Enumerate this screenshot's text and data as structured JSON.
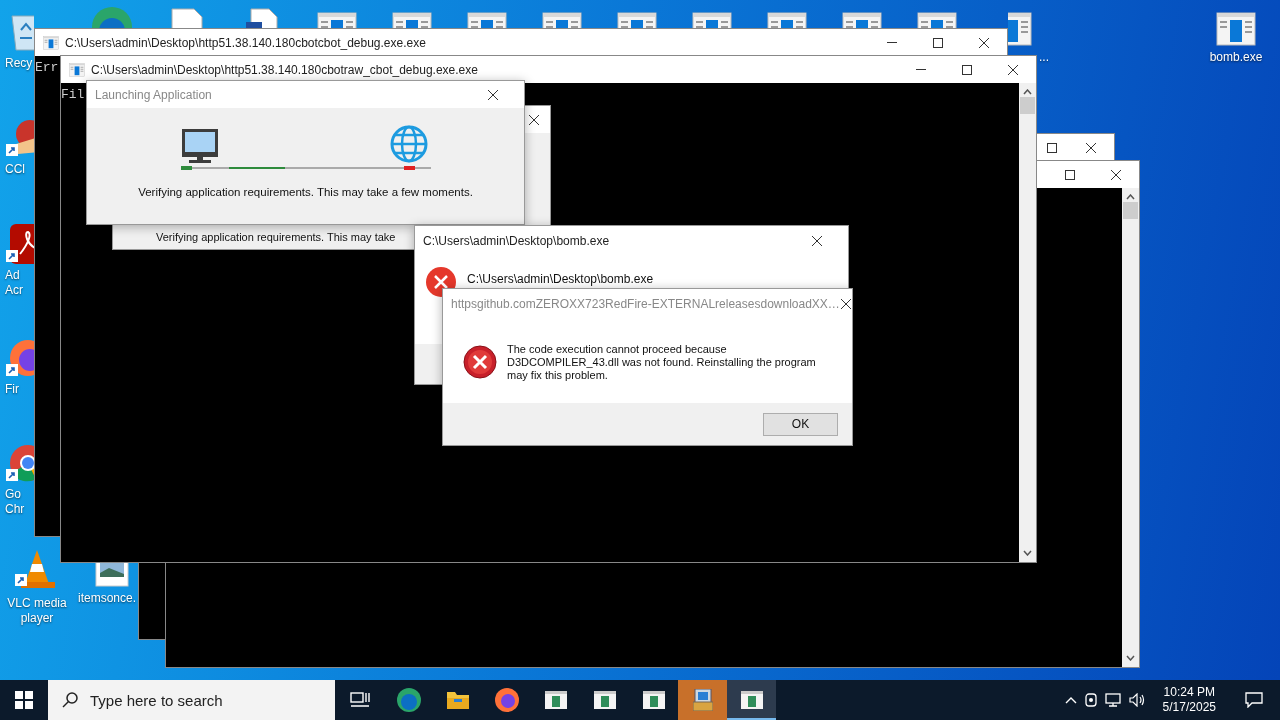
{
  "desktop_icons": [
    {
      "kind": "recycle-bin",
      "label": "Recy"
    },
    {
      "kind": "edge"
    },
    {
      "kind": "document"
    },
    {
      "kind": "word-document"
    },
    {
      "kind": "window"
    },
    {
      "kind": "window"
    },
    {
      "kind": "window"
    },
    {
      "kind": "window"
    },
    {
      "kind": "window"
    },
    {
      "kind": "window"
    },
    {
      "kind": "window"
    },
    {
      "kind": "window"
    },
    {
      "kind": "window"
    },
    {
      "kind": "window",
      "label": "..."
    },
    {
      "kind": "ccleaner",
      "label": "CCl"
    },
    {
      "kind": "acrobat",
      "label": "Ad Acr"
    },
    {
      "kind": "firefox",
      "label": "Fir"
    },
    {
      "kind": "chrome",
      "label": "Go Chr"
    },
    {
      "kind": "vlc",
      "label": "VLC media player"
    },
    {
      "kind": "image",
      "label": "itemsonce."
    },
    {
      "kind": "window",
      "label": "bomb.exe"
    }
  ],
  "console_windows": [
    {
      "kind": "console"
    },
    {
      "kind": "console"
    },
    {
      "kind": "console",
      "title": "C:\\Users\\admin\\Desktop\\http51.38.140.180cbotcbot_debug.exe.exe",
      "text": "Err"
    },
    {
      "kind": "console",
      "title": "C:\\Users\\admin\\Desktop\\http51.38.140.180cbotraw_cbot_debug.exe.exe",
      "text": "Fil"
    }
  ],
  "launch_dialog_behind": {
    "text": "Verifying application requirements. This may take"
  },
  "launch_dialog": {
    "title": "Launching Application",
    "text": "Verifying application requirements. This may take a few moments."
  },
  "bomb_dialog": {
    "title": "C:\\Users\\admin\\Desktop\\bomb.exe",
    "message": "C:\\Users\\admin\\Desktop\\bomb.exe"
  },
  "error_dialog": {
    "title": "httpsgithub.comZEROXX723RedFire-EXTERNALreleasesdownloadXX…",
    "message": "The code execution cannot proceed because D3DCOMPILER_43.dll was not found. Reinstalling the program may fix this problem.",
    "button": "OK"
  },
  "taskbar": {
    "search": {
      "placeholder": "Type here to search"
    },
    "apps": [
      {
        "kind": "task-view",
        "selected": false,
        "flashing": false
      },
      {
        "kind": "edge",
        "selected": false,
        "flashing": false
      },
      {
        "kind": "file-explorer",
        "selected": false,
        "flashing": false
      },
      {
        "kind": "firefox",
        "selected": false,
        "flashing": false
      },
      {
        "kind": "window",
        "selected": false,
        "flashing": false
      },
      {
        "kind": "window",
        "selected": false,
        "flashing": false
      },
      {
        "kind": "window",
        "selected": false,
        "flashing": false
      },
      {
        "kind": "installer",
        "selected": false,
        "flashing": true
      },
      {
        "kind": "window",
        "selected": true,
        "flashing": false
      }
    ],
    "clock": {
      "time": "10:24 PM",
      "date": "5/17/2025"
    }
  }
}
